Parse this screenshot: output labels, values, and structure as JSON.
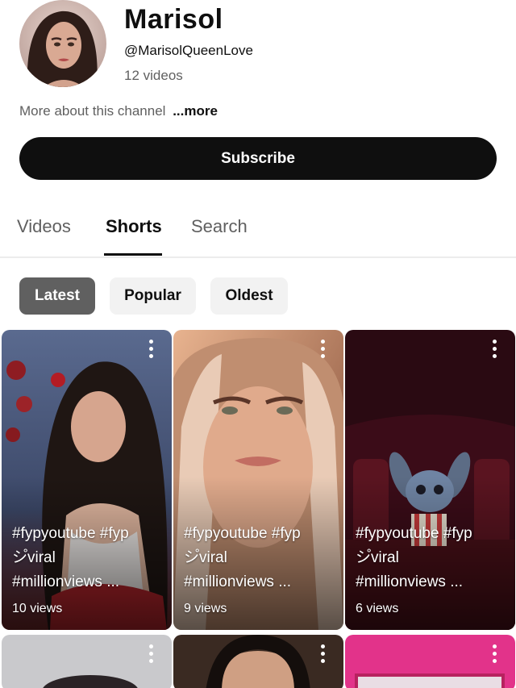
{
  "channel": {
    "name": "Marisol",
    "handle": "@MarisolQueenLove",
    "video_count": "12 videos",
    "about_text": "More about this channel",
    "about_more": "...more",
    "subscribe_label": "Subscribe"
  },
  "tabs": [
    {
      "label": "Videos",
      "active": false
    },
    {
      "label": "Shorts",
      "active": true
    },
    {
      "label": "Search",
      "active": false
    }
  ],
  "filters": [
    {
      "label": "Latest",
      "active": true
    },
    {
      "label": "Popular",
      "active": false
    },
    {
      "label": "Oldest",
      "active": false
    }
  ],
  "shorts": [
    {
      "title": "#fypyoutube #fyp\nシ゚viral\n#millionviews ...",
      "views": "10 views"
    },
    {
      "title": "#fypyoutube #fyp\nシ゚viral\n#millionviews ...",
      "views": "9 views"
    },
    {
      "title": "#fypyoutube #fyp\nシ゚viral\n#millionviews ...",
      "views": "6 views"
    }
  ],
  "colors": {
    "subscribe_bg": "#0f0f0f",
    "chip_active_bg": "#606060",
    "chip_bg": "#f2f2f2",
    "muted_text": "#606060"
  },
  "icons": [
    "more-vert-icon"
  ]
}
